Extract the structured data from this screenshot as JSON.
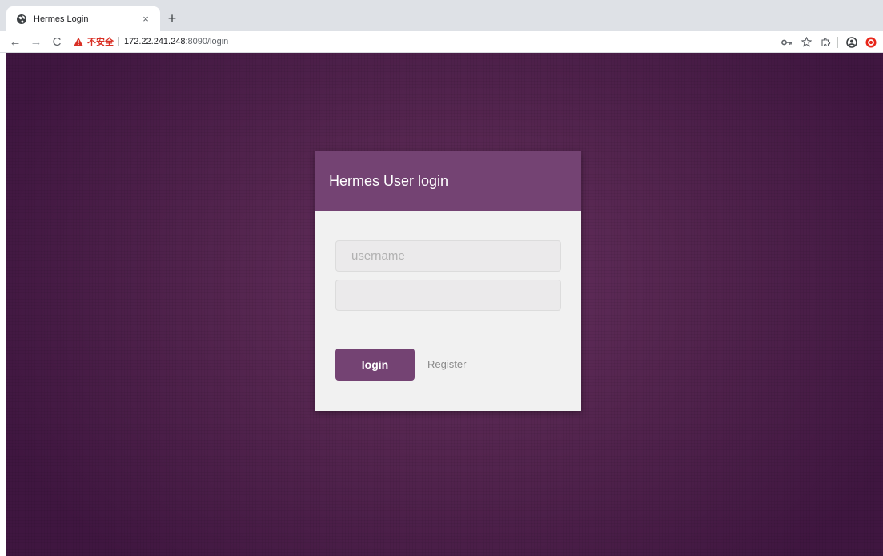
{
  "browser": {
    "tab": {
      "title": "Hermes Login",
      "close_glyph": "×",
      "favicon": "globe-icon"
    },
    "new_tab_glyph": "+",
    "nav": {
      "back_glyph": "←",
      "forward_glyph": "→",
      "reload_glyph": "C"
    },
    "omnibox": {
      "security_label": "不安全",
      "security_icon": "warning-icon",
      "url_host": "172.22.241.248",
      "url_rest": ":8090/login"
    },
    "toolbar_icons": [
      "key-icon",
      "star-icon",
      "extension-icon",
      "profile-icon",
      "extension-red-icon"
    ]
  },
  "page": {
    "colors": {
      "background": "#54254f",
      "accent": "#744373",
      "card": "#f1f1f1"
    },
    "login_card": {
      "title": "Hermes User login",
      "username_placeholder": "username",
      "username_value": "",
      "password_value": "",
      "login_label": "login",
      "register_label": "Register"
    }
  }
}
